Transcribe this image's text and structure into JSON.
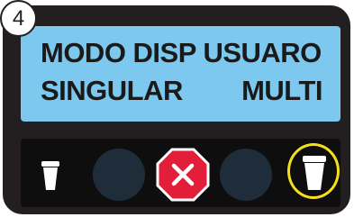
{
  "step": {
    "number": "4"
  },
  "display": {
    "line1": "MODO DISP USUARO",
    "line2_left": "SINGULAR",
    "line2_right": "MULTI",
    "background_color": "#7cc8ef"
  },
  "controls": {
    "small_cup_icon": "small-cup-icon",
    "left_button_icon": "blank-button",
    "stop_icon": "stop-x-icon",
    "right_button_icon": "blank-button",
    "large_cup_icon": "large-cup-icon",
    "stop_color": "#e31e3a",
    "highlight_color": "#f6e01b"
  }
}
